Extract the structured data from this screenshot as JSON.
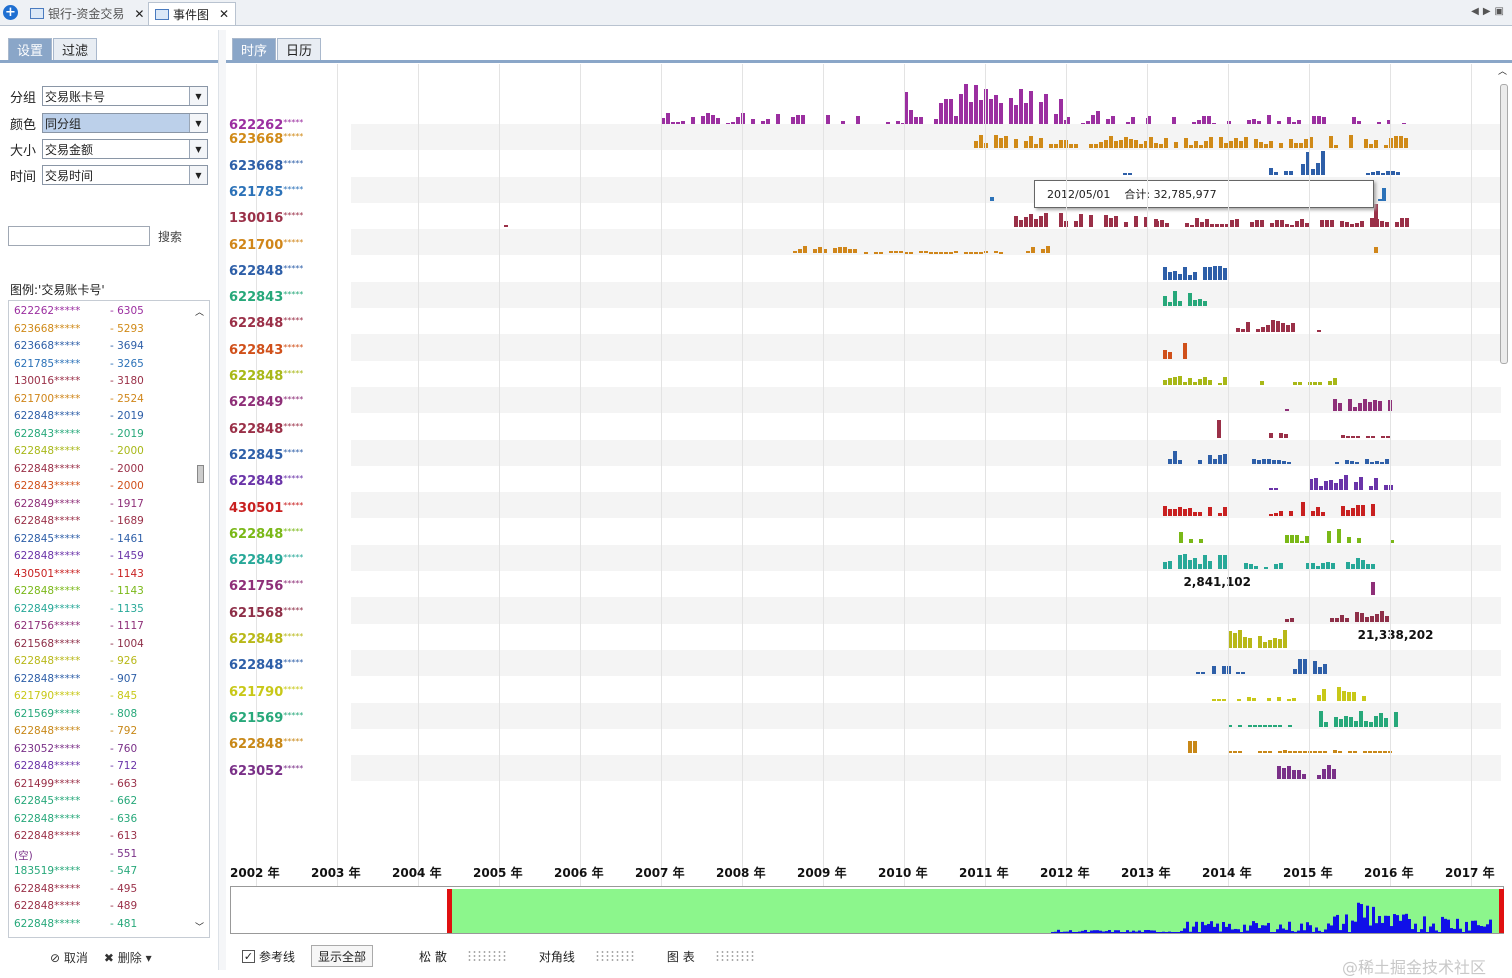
{
  "tabs": [
    {
      "label": "银行-资金交易",
      "active": false
    },
    {
      "label": "事件图",
      "active": true
    }
  ],
  "left_panel": {
    "tabs": [
      "设置",
      "过滤"
    ],
    "fields": [
      {
        "label": "分组",
        "value": "交易账卡号",
        "selected": false
      },
      {
        "label": "颜色",
        "value": "同分组",
        "selected": true
      },
      {
        "label": "大小",
        "value": "交易金额",
        "selected": false
      },
      {
        "label": "时间",
        "value": "交易时间",
        "selected": false
      }
    ],
    "search_placeholder": "",
    "search_button": "搜索",
    "legend_title": "图例:'交易账卡号'",
    "legend": [
      {
        "name": "622262*****",
        "count": "- 6305",
        "color": "#9b2fa0"
      },
      {
        "name": "623668*****",
        "count": "- 5293",
        "color": "#d08a18"
      },
      {
        "name": "623668*****",
        "count": "- 3694",
        "color": "#2e5fa8"
      },
      {
        "name": "621785*****",
        "count": "- 3265",
        "color": "#2c72b8"
      },
      {
        "name": "130016*****",
        "count": "- 3180",
        "color": "#9a3048"
      },
      {
        "name": "621700*****",
        "count": "- 2524",
        "color": "#d0861a"
      },
      {
        "name": "622848*****",
        "count": "- 2019",
        "color": "#2e5fa8"
      },
      {
        "name": "622843*****",
        "count": "- 2019",
        "color": "#27a87a"
      },
      {
        "name": "622848*****",
        "count": "- 2000",
        "color": "#a8b818"
      },
      {
        "name": "622848*****",
        "count": "- 2000",
        "color": "#9a3048"
      },
      {
        "name": "622843*****",
        "count": "- 2000",
        "color": "#d0501a"
      },
      {
        "name": "622849*****",
        "count": "- 1917",
        "color": "#8e2f78"
      },
      {
        "name": "622848*****",
        "count": "- 1689",
        "color": "#9a3048"
      },
      {
        "name": "622845*****",
        "count": "- 1461",
        "color": "#2e5fa8"
      },
      {
        "name": "622848*****",
        "count": "- 1459",
        "color": "#6a34a8"
      },
      {
        "name": "430501*****",
        "count": "- 1143",
        "color": "#c82020"
      },
      {
        "name": "622848*****",
        "count": "- 1143",
        "color": "#7ab818"
      },
      {
        "name": "622849*****",
        "count": "- 1135",
        "color": "#27a898"
      },
      {
        "name": "621756*****",
        "count": "- 1117",
        "color": "#8e2f78"
      },
      {
        "name": "621568*****",
        "count": "- 1004",
        "color": "#8e2f48"
      },
      {
        "name": "622848*****",
        "count": "- 926",
        "color": "#b8b818"
      },
      {
        "name": "622848*****",
        "count": "- 907",
        "color": "#2e5fa8"
      },
      {
        "name": "621790*****",
        "count": "- 845",
        "color": "#c8c818"
      },
      {
        "name": "621569*****",
        "count": "- 808",
        "color": "#27a87a"
      },
      {
        "name": "622848*****",
        "count": "- 792",
        "color": "#c88818"
      },
      {
        "name": "623052*****",
        "count": "- 760",
        "color": "#7a3088"
      },
      {
        "name": "622848*****",
        "count": "- 712",
        "color": "#6a34a8"
      },
      {
        "name": "621499*****",
        "count": "- 663",
        "color": "#9a3048"
      },
      {
        "name": "622845*****",
        "count": "- 662",
        "color": "#27a87a"
      },
      {
        "name": "622848*****",
        "count": "- 636",
        "color": "#27a87a"
      },
      {
        "name": "622848*****",
        "count": "- 613",
        "color": "#9a3048"
      },
      {
        "name": "(空)",
        "count": "- 551",
        "color": "#7a3088"
      },
      {
        "name": "183519*****",
        "count": "- 547",
        "color": "#27a87a"
      },
      {
        "name": "622848*****",
        "count": "- 495",
        "color": "#9a3048"
      },
      {
        "name": "622848*****",
        "count": "- 489",
        "color": "#9a3048"
      },
      {
        "name": "622848*****",
        "count": "- 481",
        "color": "#27a87a"
      }
    ],
    "bottom_buttons": [
      "取消",
      "删除"
    ]
  },
  "main": {
    "tabs": [
      "时序",
      "日历"
    ],
    "tooltip": {
      "date": "2012/05/01",
      "total": "合计: 32,785,977"
    },
    "annotations": [
      {
        "text": "2,841,102",
        "row": 18,
        "year": 2013.45
      },
      {
        "text": "21,338,202",
        "row": 20,
        "year": 2015.6
      }
    ],
    "years": [
      "2002 年",
      "2003 年",
      "2004 年",
      "2005 年",
      "2006 年",
      "2007 年",
      "2008 年",
      "2009 年",
      "2010 年",
      "2011 年",
      "2012 年",
      "2013 年",
      "2014 年",
      "2015 年",
      "2016 年",
      "2017 年"
    ],
    "bottom": {
      "ref_line": "参考线",
      "show_all": "显示全部",
      "loose": "松 散",
      "diagonal": "对角线",
      "chart": "图 表"
    }
  },
  "chart_data": {
    "type": "event-timeline",
    "x_axis": {
      "unit": "year",
      "min": 2002,
      "max": 2017.6
    },
    "rows": [
      {
        "label": "622262",
        "color": "#9b2fa0",
        "activity": [
          [
            2005.0,
            2007.0,
            0.05
          ],
          [
            2007.0,
            2010.0,
            0.28
          ],
          [
            2010.0,
            2012.0,
            0.7
          ],
          [
            2012.0,
            2013.0,
            0.35
          ],
          [
            2013.0,
            2016.3,
            0.25
          ]
        ]
      },
      {
        "label": "623668",
        "color": "#d08a18",
        "activity": [
          [
            2010.8,
            2016.3,
            0.5
          ]
        ]
      },
      {
        "label": "623668",
        "color": "#2e5fa8",
        "activity": [
          [
            2012.7,
            2012.8,
            0.05
          ],
          [
            2014.5,
            2014.8,
            0.25
          ],
          [
            2014.9,
            2015.2,
            0.9
          ],
          [
            2015.7,
            2016.1,
            0.15
          ]
        ]
      },
      {
        "label": "621785",
        "color": "#2c72b8",
        "activity": [
          [
            2011.0,
            2011.1,
            0.15
          ],
          [
            2013.8,
            2014.4,
            0.08
          ],
          [
            2015.3,
            2015.9,
            0.08
          ],
          [
            2015.9,
            2016.0,
            0.8
          ]
        ]
      },
      {
        "label": "130016",
        "color": "#9a3048",
        "activity": [
          [
            2005.0,
            2005.1,
            0.1
          ],
          [
            2011.3,
            2013.1,
            0.55
          ],
          [
            2013.1,
            2016.3,
            0.35
          ],
          [
            2015.8,
            2015.9,
            0.9
          ]
        ]
      },
      {
        "label": "621700",
        "color": "#d0861a",
        "activity": [
          [
            2008.5,
            2009.4,
            0.35
          ],
          [
            2009.5,
            2011.2,
            0.1
          ],
          [
            2011.5,
            2011.8,
            0.3
          ],
          [
            2015.8,
            2015.9,
            0.8
          ]
        ]
      },
      {
        "label": "622848",
        "color": "#2e5fa8",
        "activity": [
          [
            2013.2,
            2014.0,
            0.55
          ]
        ]
      },
      {
        "label": "622843",
        "color": "#27a87a",
        "activity": [
          [
            2013.2,
            2013.7,
            0.6
          ]
        ]
      },
      {
        "label": "622848",
        "color": "#9a3048",
        "activity": [
          [
            2014.1,
            2014.8,
            0.5
          ],
          [
            2015.1,
            2015.2,
            0.1
          ]
        ]
      },
      {
        "label": "622843",
        "color": "#d0501a",
        "activity": [
          [
            2013.2,
            2013.45,
            0.75
          ]
        ]
      },
      {
        "label": "622848",
        "color": "#a8b818",
        "activity": [
          [
            2013.2,
            2014.0,
            0.35
          ],
          [
            2014.4,
            2014.5,
            0.2
          ],
          [
            2014.8,
            2015.3,
            0.3
          ]
        ]
      },
      {
        "label": "622849",
        "color": "#8e2f78",
        "activity": [
          [
            2014.7,
            2014.8,
            0.05
          ],
          [
            2015.3,
            2016.0,
            0.5
          ]
        ]
      },
      {
        "label": "622848",
        "color": "#9a3048",
        "activity": [
          [
            2013.8,
            2013.9,
            0.8
          ],
          [
            2014.5,
            2014.7,
            0.2
          ],
          [
            2015.4,
            2016.0,
            0.1
          ]
        ]
      },
      {
        "label": "622845",
        "color": "#2e5fa8",
        "activity": [
          [
            2013.2,
            2014.0,
            0.5
          ],
          [
            2014.3,
            2014.8,
            0.2
          ],
          [
            2015.2,
            2016.0,
            0.2
          ]
        ]
      },
      {
        "label": "622848",
        "color": "#6a34a8",
        "activity": [
          [
            2014.5,
            2014.6,
            0.05
          ],
          [
            2015.0,
            2016.0,
            0.6
          ]
        ]
      },
      {
        "label": "430501",
        "color": "#c82020",
        "activity": [
          [
            2013.2,
            2014.0,
            0.4
          ],
          [
            2014.5,
            2014.8,
            0.3
          ],
          [
            2014.9,
            2015.8,
            0.6
          ],
          [
            2016.0,
            2016.1,
            0.15
          ]
        ]
      },
      {
        "label": "622848",
        "color": "#7ab818",
        "activity": [
          [
            2013.4,
            2013.8,
            0.4
          ],
          [
            2014.7,
            2015.0,
            0.3
          ],
          [
            2015.1,
            2015.7,
            0.6
          ],
          [
            2016.0,
            2016.1,
            0.1
          ]
        ]
      },
      {
        "label": "622849",
        "color": "#27a898",
        "activity": [
          [
            2013.2,
            2014.0,
            0.7
          ],
          [
            2014.2,
            2014.7,
            0.25
          ],
          [
            2014.9,
            2015.8,
            0.45
          ]
        ]
      },
      {
        "label": "621756",
        "color": "#8e2f78",
        "activity": [
          [
            2015.7,
            2015.8,
            0.7
          ]
        ]
      },
      {
        "label": "621568",
        "color": "#8e2f48",
        "activity": [
          [
            2014.7,
            2014.8,
            0.15
          ],
          [
            2015.2,
            2015.5,
            0.25
          ],
          [
            2015.5,
            2016.1,
            0.6
          ]
        ]
      },
      {
        "label": "622848",
        "color": "#b8b818",
        "activity": [
          [
            2014.0,
            2014.7,
            0.7
          ]
        ]
      },
      {
        "label": "622848",
        "color": "#2e5fa8",
        "activity": [
          [
            2013.6,
            2013.7,
            0.1
          ],
          [
            2013.8,
            2014.0,
            0.5
          ],
          [
            2014.1,
            2014.2,
            0.1
          ],
          [
            2014.8,
            2015.2,
            0.6
          ]
        ]
      },
      {
        "label": "621790",
        "color": "#c8c818",
        "activity": [
          [
            2013.8,
            2014.8,
            0.15
          ],
          [
            2015.1,
            2015.7,
            0.6
          ]
        ]
      },
      {
        "label": "621569",
        "color": "#27a87a",
        "activity": [
          [
            2014.0,
            2014.8,
            0.1
          ],
          [
            2015.0,
            2016.1,
            0.6
          ]
        ]
      },
      {
        "label": "622848",
        "color": "#c88818",
        "activity": [
          [
            2013.5,
            2013.6,
            0.7
          ],
          [
            2014.0,
            2016.0,
            0.12
          ]
        ]
      },
      {
        "label": "623052",
        "color": "#7a3088",
        "activity": [
          [
            2014.6,
            2015.3,
            0.6
          ]
        ]
      }
    ]
  }
}
